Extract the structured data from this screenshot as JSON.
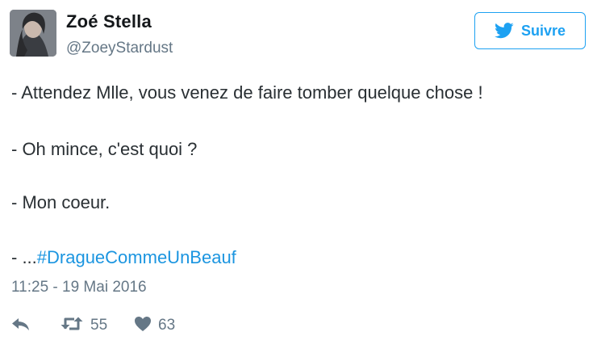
{
  "user": {
    "display_name": "Zoé Stella",
    "handle": "@ZoeyStardust"
  },
  "follow_button": {
    "label": "Suivre",
    "icon": "twitter-bird-icon"
  },
  "tweet": {
    "lines": [
      "- Attendez Mlle, vous venez de faire tomber quelque chose !",
      "- Oh mince, c'est quoi ?",
      "- Mon coeur."
    ],
    "last_line_prefix": "- ...",
    "hashtag": "#DragueCommeUnBeauf",
    "timestamp": "11:25 - 19 Mai 2016"
  },
  "actions": {
    "reply_icon": "reply-icon",
    "retweet_icon": "retweet-icon",
    "retweet_count": "55",
    "like_icon": "heart-icon",
    "like_count": "63"
  },
  "colors": {
    "accent": "#1da1f2",
    "hashtag": "#1b95e0",
    "muted": "#657786",
    "text": "#292f33"
  }
}
